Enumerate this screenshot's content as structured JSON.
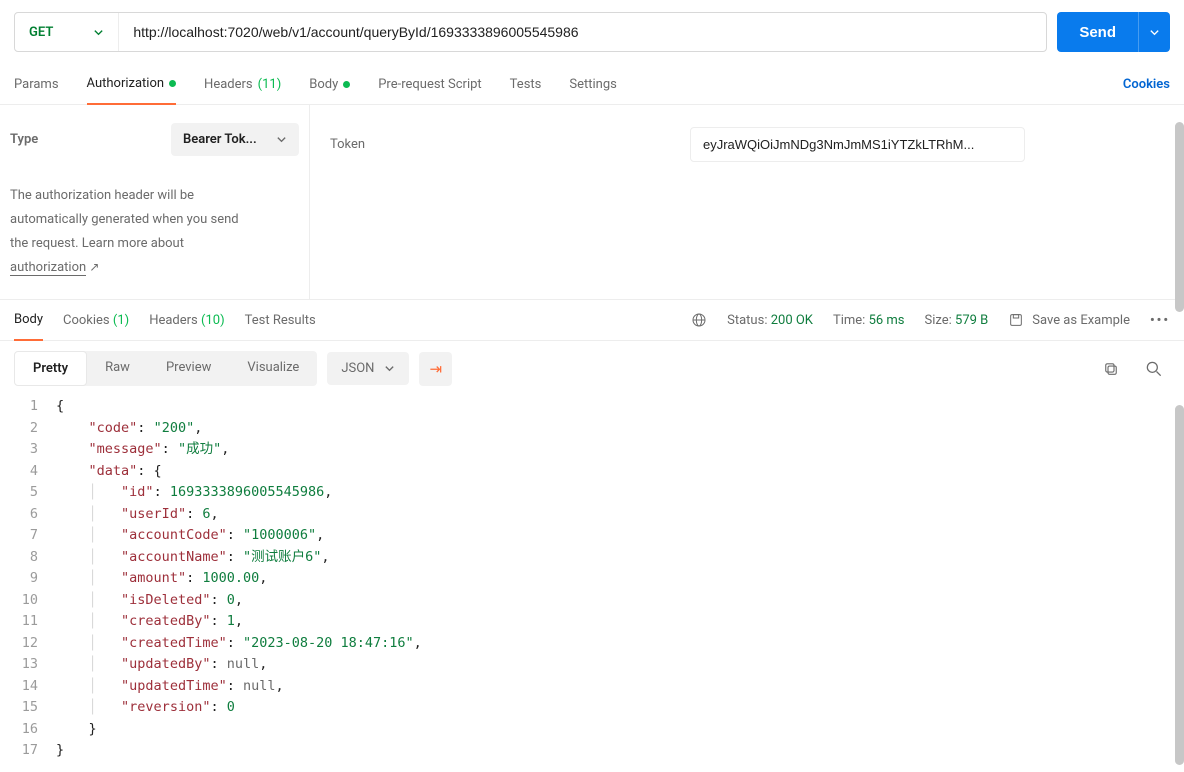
{
  "request": {
    "method": "GET",
    "url": "http://localhost:7020/web/v1/account/queryById/1693333896005545986",
    "send_label": "Send"
  },
  "req_tabs": {
    "params": "Params",
    "auth": "Authorization",
    "headers": "Headers",
    "headers_count": "(11)",
    "body": "Body",
    "prescript": "Pre-request Script",
    "tests": "Tests",
    "settings": "Settings",
    "cookies": "Cookies"
  },
  "auth": {
    "type_label": "Type",
    "type_value": "Bearer Tok...",
    "help1": "The authorization header will be",
    "help2": "automatically generated when you send",
    "help3": "the request. Learn more about",
    "help_link": "authorization",
    "token_label": "Token",
    "token_value": "eyJraWQiOiJmNDg3NmJmMS1iYTZkLTRhM..."
  },
  "resp_tabs": {
    "body": "Body",
    "cookies": "Cookies",
    "cookies_count": "(1)",
    "headers": "Headers",
    "headers_count": "(10)",
    "tests": "Test Results",
    "status_label": "Status:",
    "status_value": "200 OK",
    "time_label": "Time:",
    "time_value": "56 ms",
    "size_label": "Size:",
    "size_value": "579 B",
    "save_example": "Save as Example"
  },
  "viewer": {
    "pretty": "Pretty",
    "raw": "Raw",
    "preview": "Preview",
    "visualize": "Visualize",
    "format": "JSON"
  },
  "json_body": {
    "code": "200",
    "message": "成功",
    "data": {
      "id": 1693333896005545986,
      "userId": 6,
      "accountCode": "1000006",
      "accountName": "测试账户6",
      "amount": 1000.0,
      "isDeleted": 0,
      "createdBy": 1,
      "createdTime": "2023-08-20 18:47:16",
      "updatedBy": null,
      "updatedTime": null,
      "reversion": 0
    }
  },
  "json_lines": [
    {
      "n": 1,
      "html": "<span class='p'>{</span>"
    },
    {
      "n": 2,
      "html": "    <span class='k'>\"code\"</span><span class='p'>: </span><span class='s'>\"200\"</span><span class='p'>,</span>"
    },
    {
      "n": 3,
      "html": "    <span class='k'>\"message\"</span><span class='p'>: </span><span class='s'>\"成功\"</span><span class='p'>,</span>"
    },
    {
      "n": 4,
      "html": "    <span class='k'>\"data\"</span><span class='p'>: {</span>"
    },
    {
      "n": 5,
      "html": "    <span class='vbar'>│</span>   <span class='k'>\"id\"</span><span class='p'>: </span><span class='n'>1693333896005545986</span><span class='p'>,</span>"
    },
    {
      "n": 6,
      "html": "    <span class='vbar'>│</span>   <span class='k'>\"userId\"</span><span class='p'>: </span><span class='n'>6</span><span class='p'>,</span>"
    },
    {
      "n": 7,
      "html": "    <span class='vbar'>│</span>   <span class='k'>\"accountCode\"</span><span class='p'>: </span><span class='s'>\"1000006\"</span><span class='p'>,</span>"
    },
    {
      "n": 8,
      "html": "    <span class='vbar'>│</span>   <span class='k'>\"accountName\"</span><span class='p'>: </span><span class='s'>\"测试账户6\"</span><span class='p'>,</span>"
    },
    {
      "n": 9,
      "html": "    <span class='vbar'>│</span>   <span class='k'>\"amount\"</span><span class='p'>: </span><span class='n'>1000.00</span><span class='p'>,</span>"
    },
    {
      "n": 10,
      "html": "    <span class='vbar'>│</span>   <span class='k'>\"isDeleted\"</span><span class='p'>: </span><span class='n'>0</span><span class='p'>,</span>"
    },
    {
      "n": 11,
      "html": "    <span class='vbar'>│</span>   <span class='k'>\"createdBy\"</span><span class='p'>: </span><span class='n'>1</span><span class='p'>,</span>"
    },
    {
      "n": 12,
      "html": "    <span class='vbar'>│</span>   <span class='k'>\"createdTime\"</span><span class='p'>: </span><span class='s'>\"2023-08-20 18:47:16\"</span><span class='p'>,</span>"
    },
    {
      "n": 13,
      "html": "    <span class='vbar'>│</span>   <span class='k'>\"updatedBy\"</span><span class='p'>: </span><span class='nl'>null</span><span class='p'>,</span>"
    },
    {
      "n": 14,
      "html": "    <span class='vbar'>│</span>   <span class='k'>\"updatedTime\"</span><span class='p'>: </span><span class='nl'>null</span><span class='p'>,</span>"
    },
    {
      "n": 15,
      "html": "    <span class='vbar'>│</span>   <span class='k'>\"reversion\"</span><span class='p'>: </span><span class='n'>0</span>"
    },
    {
      "n": 16,
      "html": "    <span class='p'>}</span>"
    },
    {
      "n": 17,
      "html": "<span class='p'>}</span>"
    }
  ]
}
